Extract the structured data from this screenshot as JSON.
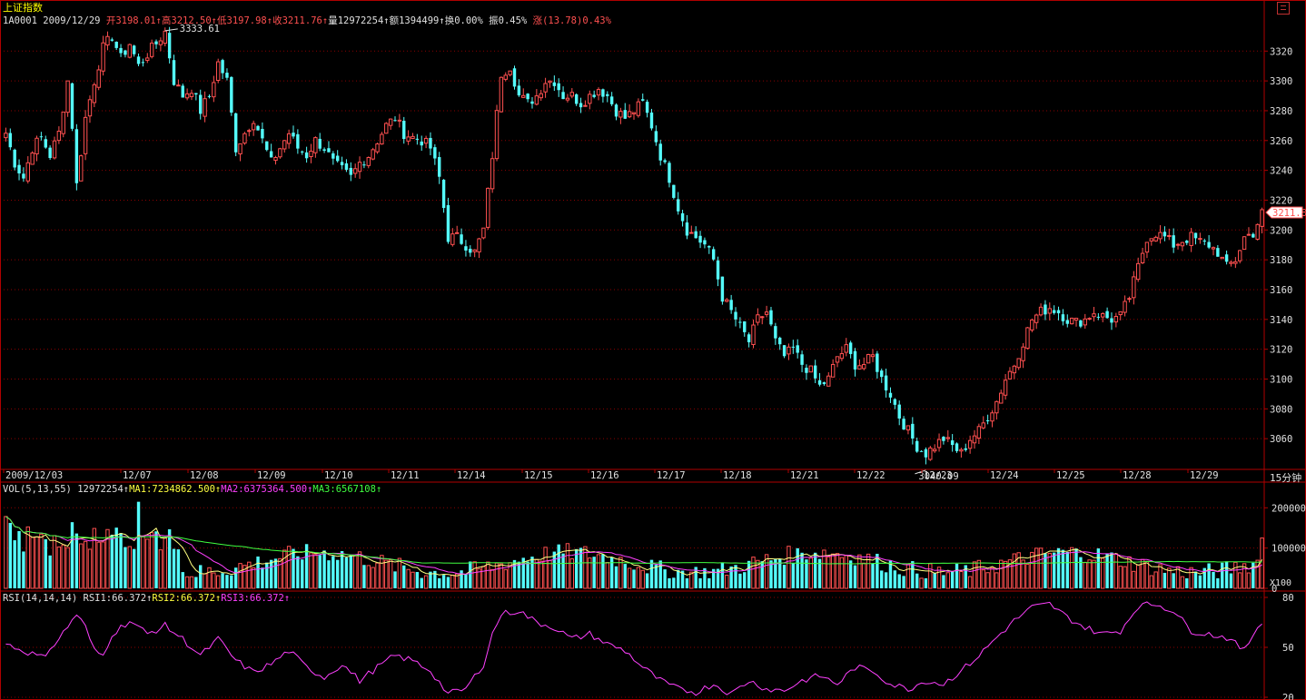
{
  "header": {
    "title": "上证指数",
    "code": "1A0001",
    "date": "2009/12/29",
    "open_label": "开",
    "open": "3198.01",
    "high_label": "高",
    "high": "3212.50",
    "low_label": "低",
    "low": "3197.98",
    "close_label": "收",
    "close": "3211.76",
    "vol_label": "量",
    "vol": "12972254",
    "amt_label": "额",
    "amt": "1394499",
    "turn_label": "换",
    "turn": "0.00%",
    "amp_label": "振",
    "amp": "0.45%",
    "chg_label": "涨",
    "chg": "(13.78)0.43%",
    "arrow": "↑"
  },
  "timeframe": "15分钟",
  "volume_header": {
    "label": "VOL(5,13,55)",
    "vol": "12972254",
    "ma1": "MA1:7234862.500",
    "ma2": "MA2:6375364.500",
    "ma3": "MA3:6567108"
  },
  "rsi_header": {
    "label": "RSI(14,14,14)",
    "rsi1": "RSI1:66.372",
    "rsi2": "RSI2:66.372",
    "rsi3": "RSI3:66.372"
  },
  "volume_unit": "X100",
  "colors": {
    "up": "#ff5050",
    "down": "#54fcfc",
    "grid": "#8b0000",
    "axis": "#b00000",
    "ma1": "#ffff80",
    "ma2": "#ff40ff",
    "ma3": "#40ff40",
    "rsi": "#ff40ff"
  },
  "chart_data": [
    {
      "type": "candlestick",
      "title": "上证指数",
      "x_labels": [
        "2009/12/03",
        "12/07",
        "12/08",
        "12/09",
        "12/10",
        "12/11",
        "12/14",
        "12/15",
        "12/16",
        "12/17",
        "12/18",
        "12/21",
        "12/22",
        "12/23",
        "12/24",
        "12/25",
        "12/28",
        "12/29"
      ],
      "y_ticks": [
        3060,
        3080,
        3100,
        3120,
        3140,
        3160,
        3180,
        3200,
        3220,
        3240,
        3260,
        3280,
        3300,
        3320
      ],
      "ylim": [
        3040,
        3336
      ],
      "annotations": [
        {
          "text": "3333.61"
        },
        {
          "text": "3040.09"
        }
      ],
      "current_price_label": "3211.8",
      "close_path": [
        [
          0,
          3265
        ],
        [
          2,
          3245
        ],
        [
          4,
          3235
        ],
        [
          6,
          3255
        ],
        [
          8,
          3262
        ],
        [
          10,
          3250
        ],
        [
          12,
          3265
        ],
        [
          14,
          3300
        ],
        [
          15,
          3270
        ],
        [
          16,
          3230
        ],
        [
          18,
          3275
        ],
        [
          20,
          3300
        ],
        [
          22,
          3322
        ],
        [
          24,
          3330
        ],
        [
          26,
          3315
        ],
        [
          28,
          3325
        ],
        [
          30,
          3310
        ],
        [
          32,
          3318
        ],
        [
          34,
          3325
        ],
        [
          36,
          3333
        ],
        [
          38,
          3300
        ],
        [
          40,
          3290
        ],
        [
          42,
          3295
        ],
        [
          44,
          3280
        ],
        [
          46,
          3290
        ],
        [
          48,
          3312
        ],
        [
          50,
          3300
        ],
        [
          52,
          3255
        ],
        [
          54,
          3265
        ],
        [
          56,
          3275
        ],
        [
          58,
          3260
        ],
        [
          60,
          3245
        ],
        [
          62,
          3255
        ],
        [
          64,
          3265
        ],
        [
          66,
          3255
        ],
        [
          68,
          3250
        ],
        [
          70,
          3260
        ],
        [
          72,
          3255
        ],
        [
          74,
          3245
        ],
        [
          76,
          3240
        ],
        [
          78,
          3235
        ],
        [
          80,
          3245
        ],
        [
          82,
          3250
        ],
        [
          84,
          3260
        ],
        [
          86,
          3270
        ],
        [
          88,
          3275
        ],
        [
          90,
          3265
        ],
        [
          92,
          3262
        ],
        [
          94,
          3260
        ],
        [
          96,
          3255
        ],
        [
          98,
          3235
        ],
        [
          100,
          3195
        ],
        [
          102,
          3195
        ],
        [
          104,
          3190
        ],
        [
          106,
          3185
        ],
        [
          108,
          3200
        ],
        [
          110,
          3250
        ],
        [
          112,
          3305
        ],
        [
          114,
          3310
        ],
        [
          116,
          3290
        ],
        [
          118,
          3285
        ],
        [
          120,
          3290
        ],
        [
          122,
          3300
        ],
        [
          124,
          3300
        ],
        [
          126,
          3290
        ],
        [
          128,
          3290
        ],
        [
          130,
          3285
        ],
        [
          132,
          3290
        ],
        [
          134,
          3295
        ],
        [
          136,
          3290
        ],
        [
          138,
          3280
        ],
        [
          140,
          3275
        ],
        [
          142,
          3280
        ],
        [
          144,
          3285
        ],
        [
          146,
          3270
        ],
        [
          148,
          3250
        ],
        [
          150,
          3235
        ],
        [
          152,
          3215
        ],
        [
          154,
          3200
        ],
        [
          156,
          3195
        ],
        [
          158,
          3190
        ],
        [
          160,
          3180
        ],
        [
          162,
          3155
        ],
        [
          164,
          3145
        ],
        [
          166,
          3135
        ],
        [
          168,
          3125
        ],
        [
          170,
          3140
        ],
        [
          172,
          3145
        ],
        [
          174,
          3125
        ],
        [
          176,
          3115
        ],
        [
          178,
          3120
        ],
        [
          180,
          3110
        ],
        [
          182,
          3105
        ],
        [
          184,
          3095
        ],
        [
          186,
          3100
        ],
        [
          188,
          3115
        ],
        [
          190,
          3120
        ],
        [
          192,
          3110
        ],
        [
          194,
          3110
        ],
        [
          196,
          3115
        ],
        [
          198,
          3100
        ],
        [
          200,
          3090
        ],
        [
          202,
          3075
        ],
        [
          204,
          3065
        ],
        [
          206,
          3055
        ],
        [
          208,
          3050
        ],
        [
          210,
          3055
        ],
        [
          212,
          3060
        ],
        [
          214,
          3055
        ],
        [
          216,
          3050
        ],
        [
          218,
          3060
        ],
        [
          220,
          3065
        ],
        [
          222,
          3075
        ],
        [
          224,
          3085
        ],
        [
          226,
          3100
        ],
        [
          228,
          3110
        ],
        [
          230,
          3125
        ],
        [
          232,
          3140
        ],
        [
          234,
          3145
        ],
        [
          236,
          3148
        ],
        [
          238,
          3145
        ],
        [
          240,
          3140
        ],
        [
          242,
          3138
        ],
        [
          244,
          3140
        ],
        [
          246,
          3145
        ],
        [
          248,
          3142
        ],
        [
          250,
          3140
        ],
        [
          252,
          3142
        ],
        [
          254,
          3155
        ],
        [
          256,
          3175
        ],
        [
          258,
          3195
        ],
        [
          260,
          3198
        ],
        [
          262,
          3195
        ],
        [
          264,
          3190
        ],
        [
          266,
          3193
        ],
        [
          268,
          3195
        ],
        [
          270,
          3192
        ],
        [
          272,
          3190
        ],
        [
          274,
          3185
        ],
        [
          276,
          3175
        ],
        [
          278,
          3180
        ],
        [
          280,
          3195
        ],
        [
          282,
          3198
        ],
        [
          284,
          3211
        ]
      ],
      "n_bars": 285
    },
    {
      "type": "bar",
      "title": "VOL(5,13,55)",
      "y_ticks": [
        0,
        100000,
        200000
      ],
      "ylim": [
        0,
        230000
      ]
    },
    {
      "type": "line",
      "title": "RSI(14,14,14)",
      "y_ticks": [
        20,
        50,
        80
      ],
      "ylim": [
        20,
        80
      ],
      "rsi_path": [
        [
          0,
          52
        ],
        [
          4,
          48
        ],
        [
          8,
          44
        ],
        [
          12,
          55
        ],
        [
          16,
          70
        ],
        [
          18,
          62
        ],
        [
          20,
          48
        ],
        [
          22,
          45
        ],
        [
          24,
          58
        ],
        [
          28,
          66
        ],
        [
          32,
          58
        ],
        [
          36,
          63
        ],
        [
          40,
          55
        ],
        [
          44,
          45
        ],
        [
          48,
          55
        ],
        [
          52,
          42
        ],
        [
          56,
          35
        ],
        [
          60,
          40
        ],
        [
          64,
          48
        ],
        [
          68,
          38
        ],
        [
          72,
          32
        ],
        [
          76,
          40
        ],
        [
          80,
          30
        ],
        [
          84,
          38
        ],
        [
          88,
          45
        ],
        [
          92,
          42
        ],
        [
          96,
          36
        ],
        [
          100,
          22
        ],
        [
          104,
          25
        ],
        [
          108,
          40
        ],
        [
          110,
          58
        ],
        [
          112,
          70
        ],
        [
          116,
          72
        ],
        [
          120,
          65
        ],
        [
          124,
          62
        ],
        [
          128,
          55
        ],
        [
          132,
          58
        ],
        [
          136,
          52
        ],
        [
          140,
          48
        ],
        [
          144,
          38
        ],
        [
          148,
          30
        ],
        [
          152,
          25
        ],
        [
          156,
          23
        ],
        [
          160,
          28
        ],
        [
          164,
          22
        ],
        [
          168,
          30
        ],
        [
          172,
          25
        ],
        [
          176,
          24
        ],
        [
          180,
          30
        ],
        [
          184,
          33
        ],
        [
          188,
          28
        ],
        [
          192,
          38
        ],
        [
          196,
          36
        ],
        [
          200,
          28
        ],
        [
          204,
          25
        ],
        [
          208,
          30
        ],
        [
          212,
          28
        ],
        [
          216,
          36
        ],
        [
          220,
          45
        ],
        [
          224,
          56
        ],
        [
          228,
          66
        ],
        [
          232,
          74
        ],
        [
          236,
          76
        ],
        [
          240,
          68
        ],
        [
          244,
          62
        ],
        [
          248,
          58
        ],
        [
          252,
          60
        ],
        [
          256,
          75
        ],
        [
          260,
          76
        ],
        [
          264,
          72
        ],
        [
          268,
          60
        ],
        [
          272,
          58
        ],
        [
          276,
          56
        ],
        [
          280,
          48
        ],
        [
          282,
          58
        ],
        [
          284,
          66
        ]
      ]
    }
  ]
}
